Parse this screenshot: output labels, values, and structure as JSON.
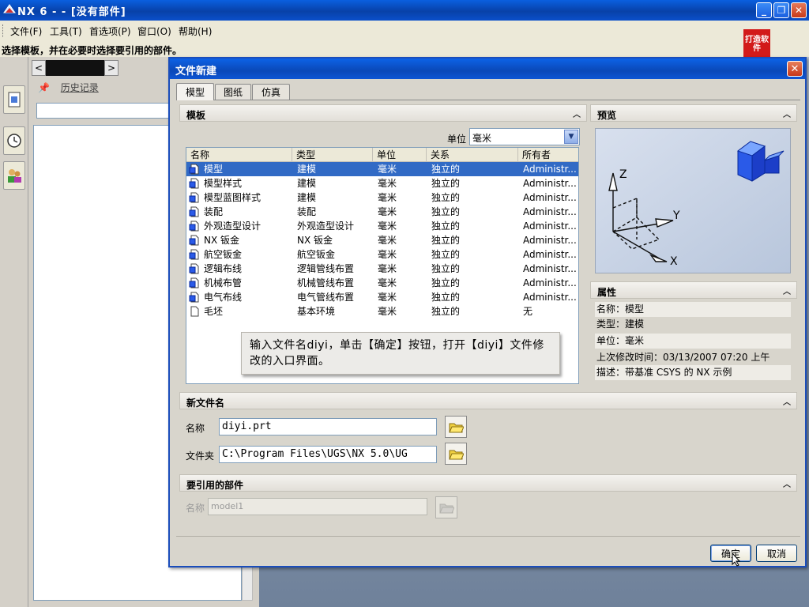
{
  "window": {
    "title": "NX 6 - - [没有部件]",
    "caption_buttons": [
      "minimize",
      "restore",
      "close"
    ]
  },
  "menubar": [
    "文件(F)",
    "工具(T)",
    "首选项(P)",
    "窗口(O)",
    "帮助(H)"
  ],
  "status_text": "选择模板，并在必要时选择要引用的部件。",
  "logo_text": "打造软件",
  "resource_bar": {
    "icons": [
      "part-navigator-icon",
      "history-clock-icon",
      "roles-icon"
    ]
  },
  "navigator": {
    "history_label": "历史记录",
    "prev": "<",
    "next": ">"
  },
  "dialog": {
    "title": "文件新建",
    "close": "✕",
    "tabs": [
      "模型",
      "图纸",
      "仿真"
    ],
    "active_tab": "模型",
    "templates_section": {
      "title": "模板",
      "units_label": "单位",
      "units_value": "毫米",
      "columns": [
        "名称",
        "类型",
        "单位",
        "关系",
        "所有者"
      ],
      "rows": [
        {
          "name": "模型",
          "type": "建模",
          "units": "毫米",
          "relation": "独立的",
          "owner": "Administr...",
          "selected": true,
          "icon": "model-icon"
        },
        {
          "name": "模型样式",
          "type": "建模",
          "units": "毫米",
          "relation": "独立的",
          "owner": "Administr...",
          "selected": false,
          "icon": "model-icon"
        },
        {
          "name": "模型蓝图样式",
          "type": "建模",
          "units": "毫米",
          "relation": "独立的",
          "owner": "Administr...",
          "selected": false,
          "icon": "model-icon"
        },
        {
          "name": "装配",
          "type": "装配",
          "units": "毫米",
          "relation": "独立的",
          "owner": "Administr...",
          "selected": false,
          "icon": "assembly-icon"
        },
        {
          "name": "外观造型设计",
          "type": "外观造型设计",
          "units": "毫米",
          "relation": "独立的",
          "owner": "Administr...",
          "selected": false,
          "icon": "shape-studio-icon"
        },
        {
          "name": "NX 钣金",
          "type": "NX 钣金",
          "units": "毫米",
          "relation": "独立的",
          "owner": "Administr...",
          "selected": false,
          "icon": "sheet-metal-icon"
        },
        {
          "name": "航空钣金",
          "type": "航空钣金",
          "units": "毫米",
          "relation": "独立的",
          "owner": "Administr...",
          "selected": false,
          "icon": "aero-sheet-metal-icon"
        },
        {
          "name": "逻辑布线",
          "type": "逻辑管线布置",
          "units": "毫米",
          "relation": "独立的",
          "owner": "Administr...",
          "selected": false,
          "icon": "logical-routing-icon"
        },
        {
          "name": "机械布管",
          "type": "机械管线布置",
          "units": "毫米",
          "relation": "独立的",
          "owner": "Administr...",
          "selected": false,
          "icon": "mech-routing-icon"
        },
        {
          "name": "电气布线",
          "type": "电气管线布置",
          "units": "毫米",
          "relation": "独立的",
          "owner": "Administr...",
          "selected": false,
          "icon": "electrical-routing-icon"
        },
        {
          "name": "毛坯",
          "type": "基本环境",
          "units": "毫米",
          "relation": "独立的",
          "owner": "无",
          "selected": false,
          "icon": "blank-file-icon"
        }
      ]
    },
    "callout_text": "输入文件名diyi，单击【确定】按钮，打开【diyi】文件修改的入口界面。",
    "preview_section": {
      "title": "预览",
      "axes": [
        "Z",
        "Y",
        "X"
      ]
    },
    "properties_section": {
      "title": "属性",
      "items": [
        "名称：模型",
        "类型：建模",
        "单位：毫米",
        "上次修改时间：03/13/2007 07:20 上午",
        "描述：带基准 CSYS 的 NX 示例"
      ]
    },
    "new_file_section": {
      "title": "新文件名",
      "name_label": "名称",
      "name_value": "diyi.prt",
      "folder_label": "文件夹",
      "folder_value": "C:\\Program Files\\UGS\\NX 5.0\\UG"
    },
    "referenced_section": {
      "title": "要引用的部件",
      "name_label": "名称",
      "name_value": "model1"
    },
    "ok_label": "确定",
    "cancel_label": "取消"
  }
}
